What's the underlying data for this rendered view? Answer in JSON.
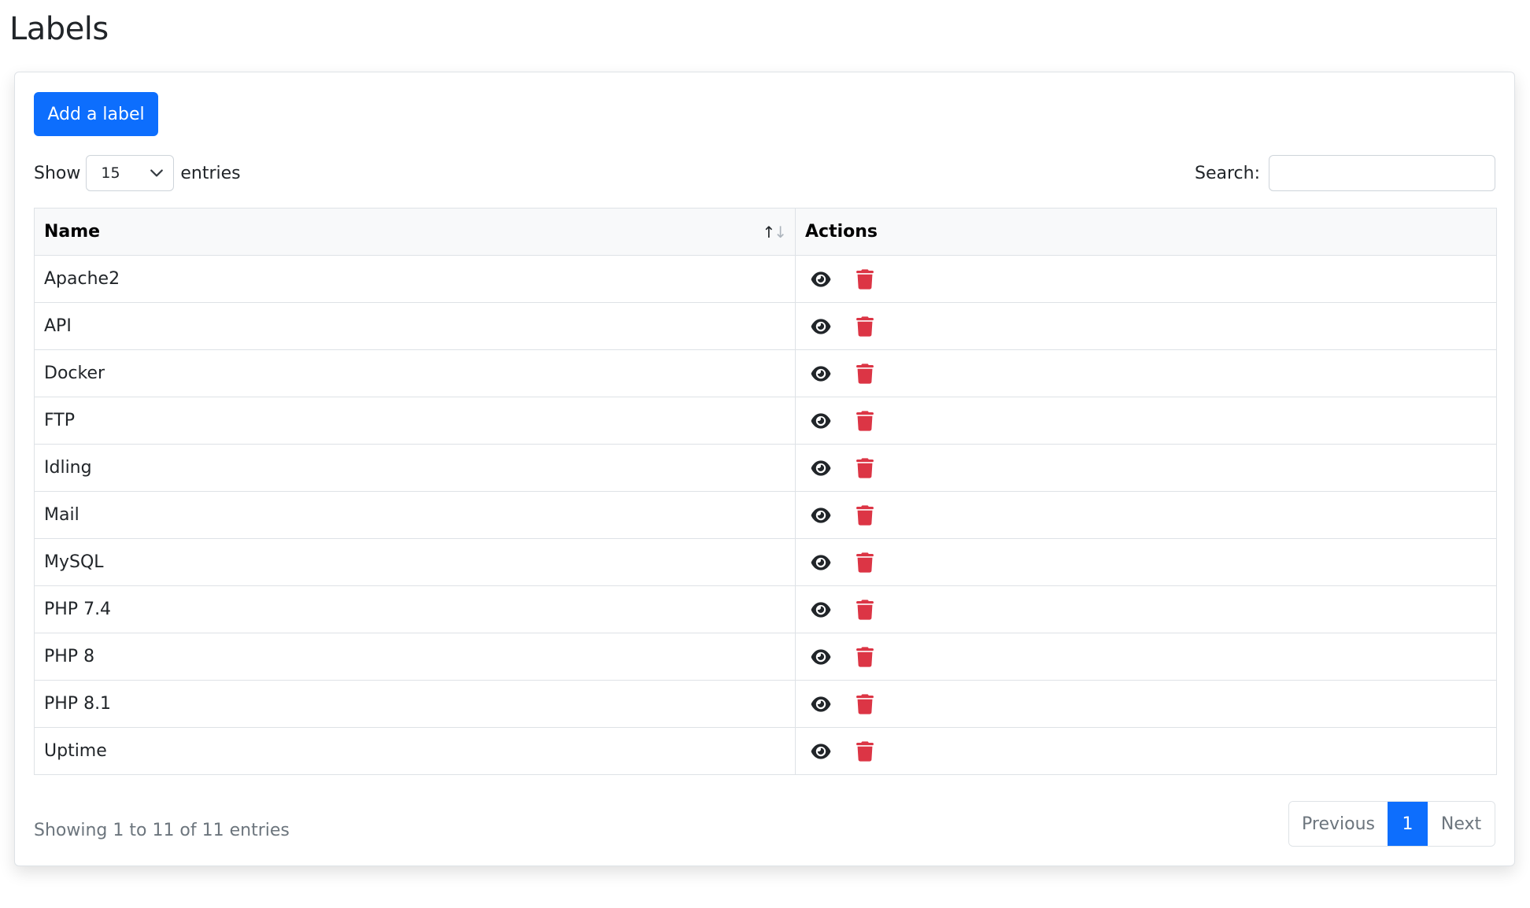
{
  "page": {
    "title": "Labels"
  },
  "toolbar": {
    "add_label": "Add a label"
  },
  "length_control": {
    "prefix": "Show",
    "value": "15",
    "suffix": "entries"
  },
  "search": {
    "label": "Search:",
    "value": "",
    "placeholder": ""
  },
  "table": {
    "columns": [
      {
        "label": "Name",
        "sortable": true,
        "sort_icon": "sort-up-down-icon"
      },
      {
        "label": "Actions"
      }
    ],
    "rows": [
      {
        "name": "Apache2"
      },
      {
        "name": "API"
      },
      {
        "name": "Docker"
      },
      {
        "name": "FTP"
      },
      {
        "name": "Idling"
      },
      {
        "name": "Mail"
      },
      {
        "name": "MySQL"
      },
      {
        "name": "PHP 7.4"
      },
      {
        "name": "PHP 8"
      },
      {
        "name": "PHP 8.1"
      },
      {
        "name": "Uptime"
      }
    ],
    "row_actions": [
      {
        "icon": "eye-icon",
        "label": "View"
      },
      {
        "icon": "trash-icon",
        "label": "Delete",
        "color": "#dc3545"
      }
    ]
  },
  "footer": {
    "info": "Showing 1 to 11 of 11 entries",
    "pagination": {
      "previous": "Previous",
      "current": "1",
      "next": "Next"
    }
  },
  "colors": {
    "primary": "#0d6efd",
    "danger": "#dc3545",
    "muted": "#6c757d"
  }
}
